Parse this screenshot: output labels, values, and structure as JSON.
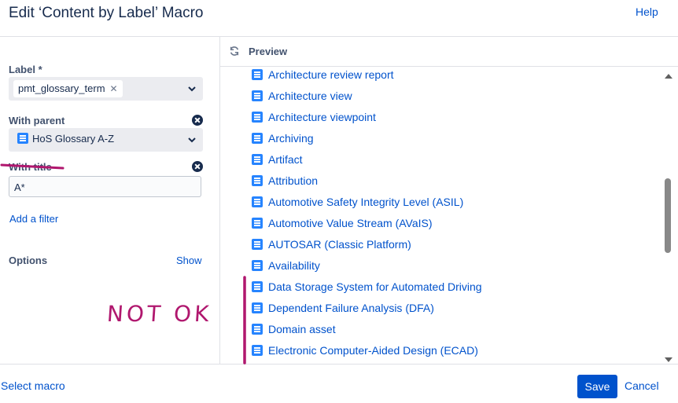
{
  "header": {
    "title": "Edit ‘Content by Label’ Macro",
    "help": "Help"
  },
  "form": {
    "label_title": "Label *",
    "label_chip": "pmt_glossary_term",
    "parent_title": "With parent",
    "parent_value": "HoS Glossary A-Z",
    "with_title_title": "With title",
    "with_title_value": "A*",
    "add_filter": "Add a filter",
    "options_title": "Options",
    "options_show": "Show"
  },
  "preview": {
    "heading": "Preview",
    "items": [
      "Architecture review report",
      "Architecture view",
      "Architecture viewpoint",
      "Archiving",
      "Artifact",
      "Attribution",
      "Automotive Safety Integrity Level (ASIL)",
      "Automotive Value Stream (AVaIS)",
      "AUTOSAR (Classic Platform)",
      "Availability",
      "Data Storage System for Automated Driving",
      "Dependent Failure Analysis (DFA)",
      "Domain asset",
      "Electronic Computer-Aided Design (ECAD)"
    ]
  },
  "footer": {
    "select_macro": "Select macro",
    "save": "Save",
    "cancel": "Cancel"
  },
  "annotation": {
    "text": "NOT OK",
    "color": "#b0176e"
  },
  "colors": {
    "link": "#0052cc",
    "primary": "#0052cc",
    "doc_icon": "#2684ff"
  },
  "icons": [
    "refresh-icon",
    "document-icon",
    "close-icon",
    "chevron-down-icon",
    "clear-icon"
  ]
}
